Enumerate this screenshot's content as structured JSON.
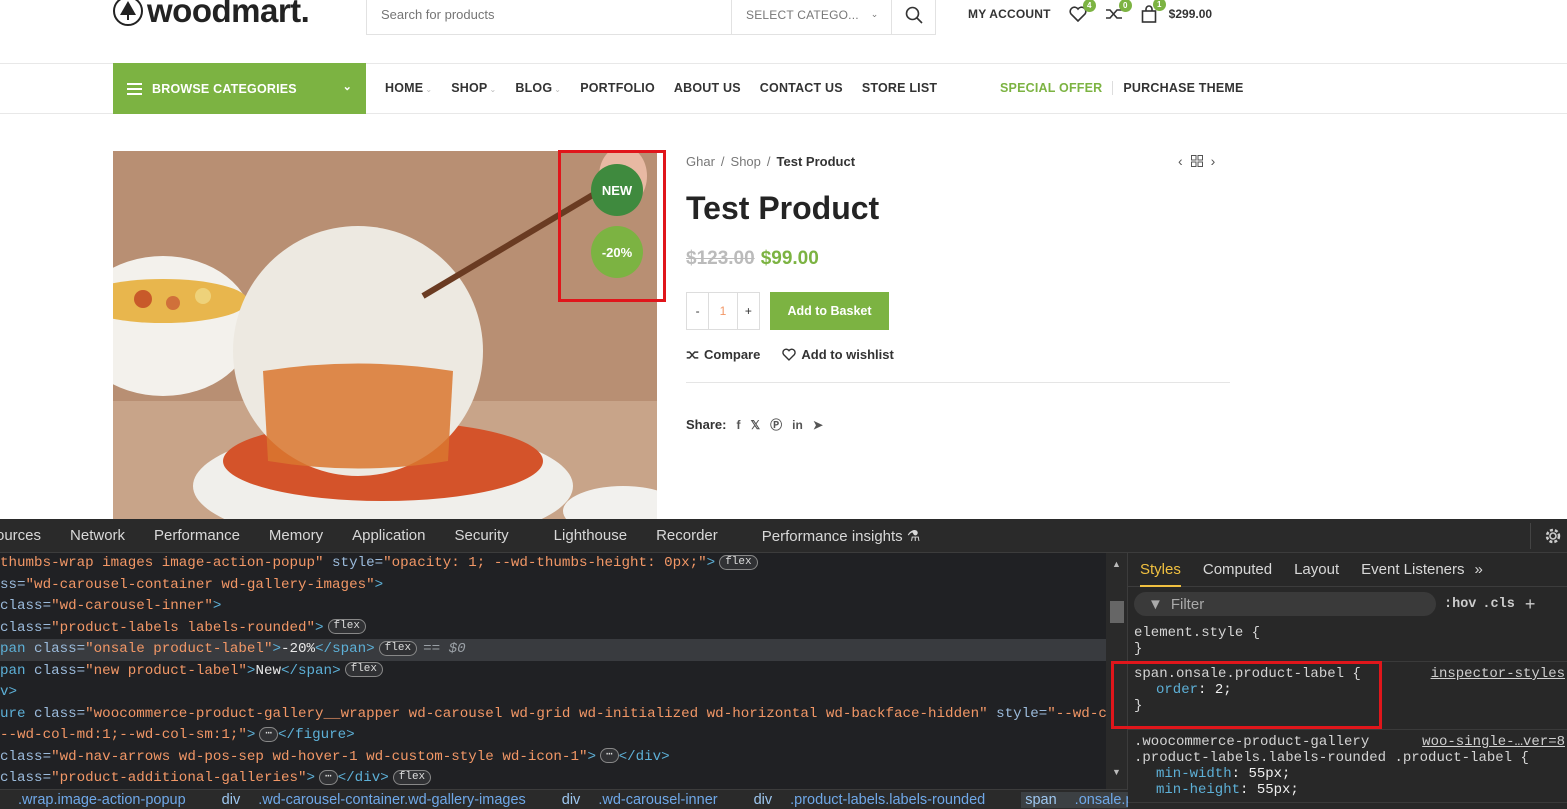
{
  "header": {
    "logo": "woodmart.",
    "search": {
      "placeholder": "Search for products",
      "category": "SELECT CATEGO..."
    },
    "account": "MY ACCOUNT",
    "wishlist_count": "4",
    "compare_count": "0",
    "cart_count": "1",
    "cart_total": "$299.00"
  },
  "nav": {
    "browse": "BROWSE CATEGORIES",
    "items": [
      {
        "label": "HOME",
        "caret": true
      },
      {
        "label": "SHOP",
        "caret": true
      },
      {
        "label": "BLOG",
        "caret": true
      },
      {
        "label": "PORTFOLIO",
        "caret": false
      },
      {
        "label": "ABOUT US",
        "caret": false
      },
      {
        "label": "CONTACT US",
        "caret": false
      },
      {
        "label": "STORE LIST",
        "caret": false
      }
    ],
    "special": "SPECIAL OFFER",
    "purchase": "PURCHASE THEME"
  },
  "product": {
    "labels": {
      "new": "NEW",
      "sale": "-20%"
    },
    "breadcrumb": [
      "Ghar",
      "Shop",
      "Test Product"
    ],
    "title": "Test Product",
    "old_price": "$123.00",
    "price": "$99.00",
    "qty": "1",
    "qty_minus": "-",
    "qty_plus": "+",
    "add_to_basket": "Add to Basket",
    "compare": "Compare",
    "wishlist": "Add to wishlist",
    "share": "Share:"
  },
  "devtools": {
    "tabs": [
      "ources",
      "Network",
      "Performance",
      "Memory",
      "Application",
      "Security",
      "Lighthouse",
      "Recorder",
      "Performance insights"
    ],
    "styles_tabs": [
      "Styles",
      "Computed",
      "Layout",
      "Event Listeners"
    ],
    "filter_placeholder": "Filter",
    "hov": ":hov",
    "cls": ".cls",
    "element_style": "element.style {",
    "close_brace": "}",
    "rule1": {
      "selector": "span.onsale.product-label {",
      "prop": "order",
      "value": "2;",
      "source": "inspector-styles"
    },
    "rule2": {
      "selector1": ".woocommerce-product-gallery",
      "selector2": ".product-labels.labels-rounded .product-label {",
      "source": "woo-single-…ver=8",
      "p1": "min-width",
      "v1": "55px;",
      "p2": "min-height",
      "v2": "55px;"
    },
    "crumbs": [
      {
        "tag": "",
        "cls": ".wrap.image-action-popup"
      },
      {
        "tag": "div",
        "cls": ".wd-carousel-container.wd-gallery-images"
      },
      {
        "tag": "div",
        "cls": ".wd-carousel-inner"
      },
      {
        "tag": "div",
        "cls": ".product-labels.labels-rounded"
      },
      {
        "tag": "span",
        "cls": ".onsale.product-label"
      }
    ],
    "code": {
      "l1a": "thumbs-wrap images image-action-popup\"",
      "l1b": " style=",
      "l1c": "\"opacity: 1; --wd-thumbs-height: 0px;\"",
      "l1d": ">",
      "l2a": "ss=",
      "l2b": "\"wd-carousel-container wd-gallery-images\"",
      "l2c": ">",
      "l3a": "class=",
      "l3b": "\"wd-carousel-inner\"",
      "l3c": ">",
      "l4a": " class=",
      "l4b": "\"product-labels labels-rounded\"",
      "l4c": ">",
      "l5a": "pan",
      "l5b": " class=",
      "l5c": "\"onsale product-label\"",
      "l5d": ">",
      "l5e": "-20%",
      "l5f": "</span>",
      "l6a": "pan",
      "l6b": " class=",
      "l6c": "\"new product-label\"",
      "l6d": ">",
      "l6e": "New",
      "l6f": "</span>",
      "l7": "v>",
      "l8a": "ure",
      "l8b": " class=",
      "l8c": "\"woocommerce-product-gallery__wrapper wd-carousel wd-grid wd-initialized wd-horizontal wd-backface-hidden\"",
      "l8d": " style=",
      "l8e": "\"--wd-col-l",
      "l9a": "--wd-col-md:1;--wd-col-sm:1;\"",
      "l9b": ">",
      "l9c": "</figure>",
      "l10a": " class=",
      "l10b": "\"wd-nav-arrows wd-pos-sep wd-hover-1 wd-custom-style wd-icon-1\"",
      "l10c": ">",
      "l10d": "</div>",
      "l11a": " class=",
      "l11b": "\"product-additional-galleries\"",
      "l11c": ">",
      "l11d": "</div>",
      "flex": "flex",
      "eq": "== $0"
    }
  },
  "colors": {
    "accent": "#7cb342",
    "new_badge": "#3f8a3e",
    "highlight": "#e0161b"
  }
}
